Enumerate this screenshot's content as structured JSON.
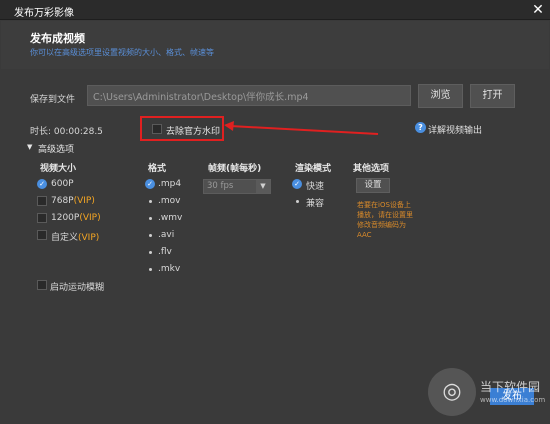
{
  "window": {
    "title": "发布万彩影像",
    "close_glyph": "✕"
  },
  "header": {
    "heading": "发布成视频",
    "subheading": "你可以在高级选项里设置视频的大小、格式、帧速等"
  },
  "save": {
    "label": "保存到文件",
    "path": "C:\\Users\\Administrator\\Desktop\\伴你成长.mp4",
    "browse_label": "浏览",
    "open_label": "打开"
  },
  "duration": "时长: 00:00:28.5",
  "watermark": {
    "label": "去除官方水印",
    "checked": false
  },
  "help": {
    "icon": "?",
    "label": "详解视频输出"
  },
  "advanced": {
    "label": "高级选项",
    "caret": "▼"
  },
  "video_size": {
    "header": "视频大小",
    "options": [
      {
        "label": "600P",
        "vip": "",
        "checked": true
      },
      {
        "label": "768P",
        "vip": "(VIP)",
        "checked": false
      },
      {
        "label": "1200P",
        "vip": "(VIP)",
        "checked": false
      },
      {
        "label": "自定义",
        "vip": "(VIP)",
        "checked": false
      }
    ]
  },
  "format": {
    "header": "格式",
    "options": [
      {
        "label": ".mp4",
        "checked": true
      },
      {
        "label": ".mov",
        "checked": false
      },
      {
        "label": ".wmv",
        "checked": false
      },
      {
        "label": ".avi",
        "checked": false
      },
      {
        "label": ".flv",
        "checked": false
      },
      {
        "label": ".mkv",
        "checked": false
      }
    ]
  },
  "fps": {
    "header": "帧频(帧每秒)",
    "value": "30 fps",
    "arrow": "▼"
  },
  "render": {
    "header": "渲染模式",
    "options": [
      {
        "label": "快速",
        "checked": true
      },
      {
        "label": "兼容",
        "checked": false
      }
    ]
  },
  "other": {
    "header": "其他选项",
    "settings_label": "设置",
    "note": "若要在iOS设备上播放，请在设置里修改音频编码为AAC"
  },
  "motion_blur": {
    "label": "启动运动模糊",
    "checked": false
  },
  "publish_label": "发布",
  "site_watermark": {
    "logo": "◎",
    "name": "当下软件园",
    "url": "www.downxia.com"
  },
  "colors": {
    "accent": "#3b7fd4",
    "vip": "#f5a623",
    "highlight": "#e02020",
    "note": "#d88a2a"
  }
}
